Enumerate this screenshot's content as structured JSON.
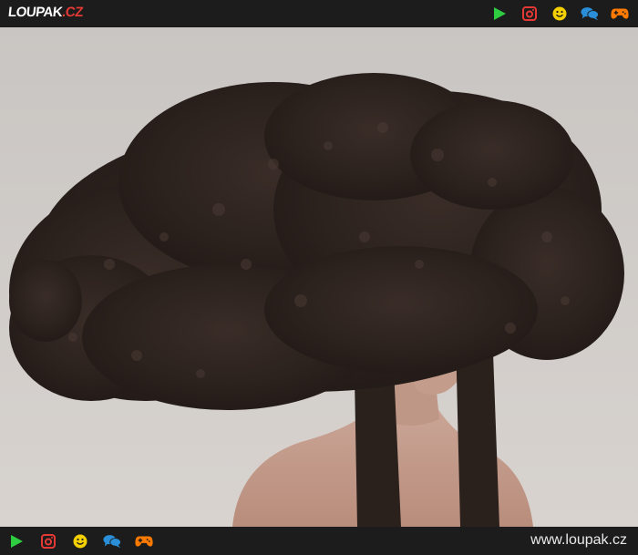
{
  "header": {
    "logo_main": "LOUPAK",
    "logo_suffix": ".CZ",
    "icons": [
      "play-icon",
      "instagram-icon",
      "smiley-icon",
      "chat-icon",
      "gamepad-icon"
    ]
  },
  "photo": {
    "subject": "woman-with-huge-afro-hair"
  },
  "footer": {
    "icons": [
      "play-icon",
      "instagram-icon",
      "smiley-icon",
      "chat-icon",
      "gamepad-icon"
    ],
    "site_url": "www.loupak.cz"
  },
  "colors": {
    "bar_background": "#1c1c1c",
    "logo_accent": "#e53935",
    "play": "#2ecc40",
    "instagram": "#e53935",
    "smiley": "#f5d000",
    "chat": "#2a8fd8",
    "gamepad": "#ff7a00",
    "photo_background": "#cfcac6",
    "hair": "#2b221f"
  }
}
